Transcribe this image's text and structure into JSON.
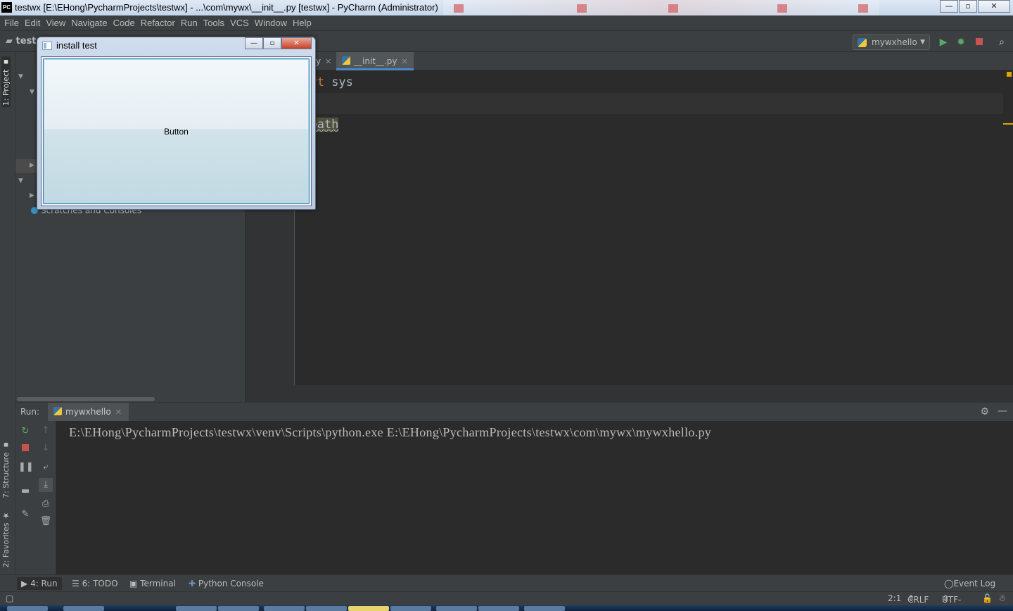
{
  "window": {
    "title": "testwx [E:\\EHong\\PycharmProjects\\testwx] - ...\\com\\mywx\\__init__.py [testwx] - PyCharm (Administrator)",
    "app_icon_text": "PC",
    "minimize_glyph": "—",
    "maximize_glyph": "▫",
    "close_glyph": "✕"
  },
  "menu": [
    "File",
    "Edit",
    "View",
    "Navigate",
    "Code",
    "Refactor",
    "Run",
    "Tools",
    "VCS",
    "Window",
    "Help"
  ],
  "navbar": {
    "crumb": "test",
    "run_config": "mywxhello"
  },
  "left_stripe": {
    "project_tab": "1: Project",
    "structure_tab": "7: Structure",
    "favorites_tab": "2: Favorites"
  },
  "project": {
    "scratches": "Scratches and Consoles"
  },
  "editor": {
    "tab_prev_suffix": "y",
    "active_tab": "__init__.py",
    "line1_kw": "port",
    "line1_rest": " sys",
    "line3_text": "s.path"
  },
  "run_panel": {
    "label": "Run:",
    "tab": "mywxhello",
    "console_line": "E:\\EHong\\PycharmProjects\\testwx\\venv\\Scripts\\python.exe E:\\EHong\\PycharmProjects\\testwx\\com\\mywx\\mywxhello.py"
  },
  "bottom_tools": {
    "run": "4: Run",
    "todo": "6: TODO",
    "terminal": "Terminal",
    "python_console": "Python Console",
    "event_log": "Event Log"
  },
  "status": {
    "position": "2:1",
    "line_sep": "CRLF",
    "encoding": "UTF-8"
  },
  "dialog": {
    "title": "install test",
    "button_label": "Button"
  },
  "colors": {
    "ide_bg": "#2b2b2b",
    "panel_bg": "#3c3f41",
    "keyword": "#cc7832",
    "run_green": "#59a869",
    "stop_red": "#c75450",
    "dialog_close": "#c64128"
  }
}
